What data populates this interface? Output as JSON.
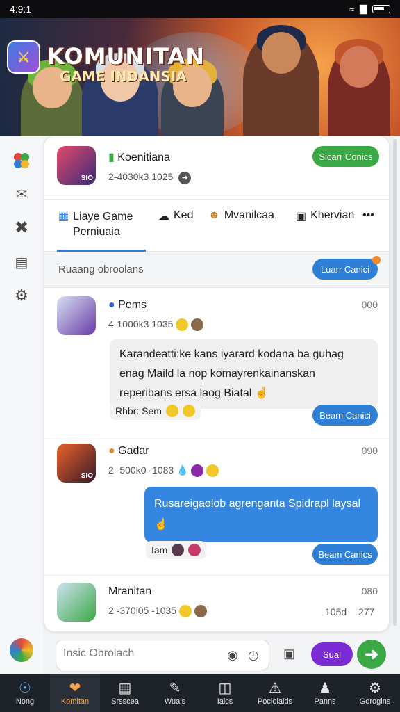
{
  "status_bar": {
    "time": "4:9:1",
    "wifi": "wifi-icon",
    "signal": "signal-icon",
    "battery": "battery-icon"
  },
  "banner": {
    "title_line1": "KOMUNITAN",
    "title_line2": "GAME INDANSIA",
    "app_icon": "game-app-icon"
  },
  "left_rail": {
    "items": [
      "apps-icon",
      "mail-icon",
      "tools-icon",
      "image-icon",
      "gear-icon"
    ],
    "profile_icon": "profile-avatar-icon"
  },
  "community_header": {
    "name": "Koenitiana",
    "meta": "2-4030k3 1025",
    "button": "Sicarr Conics",
    "avatar_badge": "SIO"
  },
  "tabs": [
    {
      "icon": "grid-icon",
      "label": "Liaye Game Perniuaia"
    },
    {
      "icon": "cloud-icon",
      "label": "Ked"
    },
    {
      "icon": "face-icon",
      "label": "Mvanilcaa"
    },
    {
      "icon": "photo-icon",
      "label": "Khervian"
    },
    {
      "icon": "more-icon",
      "label": "•••"
    }
  ],
  "section": {
    "label": "Ruaang obroolans",
    "button": "Luarr Canici"
  },
  "messages": [
    {
      "name": "Pems",
      "time": "000",
      "meta": "4-1000k3 1035",
      "text": "Karandeatti:ke kans iyarard kodana ba guhag enag Maild la nop komayrenkainanskan reperibans ersa laog Biatal",
      "reaction": "Rhbr: Sem",
      "button": "Beam Canici"
    },
    {
      "name": "Gadar",
      "time": "090",
      "meta": "2 -500k0 -1083",
      "text": "Rusareigaolob agrenganta Spidrapl laysal",
      "reaction": "Iam",
      "button": "Beam Canics",
      "avatar_badge": "SIO"
    },
    {
      "name": "Mranitan",
      "time": "080",
      "meta": "2 -370l05 -1035",
      "stats": [
        "105d",
        "277"
      ]
    }
  ],
  "compose": {
    "placeholder": "Insic Obrolach",
    "camera": "camera-icon",
    "timer": "timer-icon",
    "media": "media-icon",
    "button": "Sual",
    "send": "send-icon"
  },
  "bottom_nav": [
    {
      "icon": "compass-icon",
      "label": "Nong"
    },
    {
      "icon": "heart-icon",
      "label": "Komitan",
      "active": true
    },
    {
      "icon": "grid-icon",
      "label": "Srsscea"
    },
    {
      "icon": "brush-icon",
      "label": "Wuals"
    },
    {
      "icon": "tablet-icon",
      "label": "Ialcs"
    },
    {
      "icon": "alert-icon",
      "label": "Pociolalds"
    },
    {
      "icon": "people-icon",
      "label": "Panns"
    },
    {
      "icon": "gear-person-icon",
      "label": "Gorogins"
    }
  ],
  "colors": {
    "accent_green": "#3aa844",
    "accent_blue": "#2f7fd6",
    "accent_purple": "#7a2bd6",
    "nav_bg": "#1e2229",
    "nav_active": "#f5a54a"
  }
}
